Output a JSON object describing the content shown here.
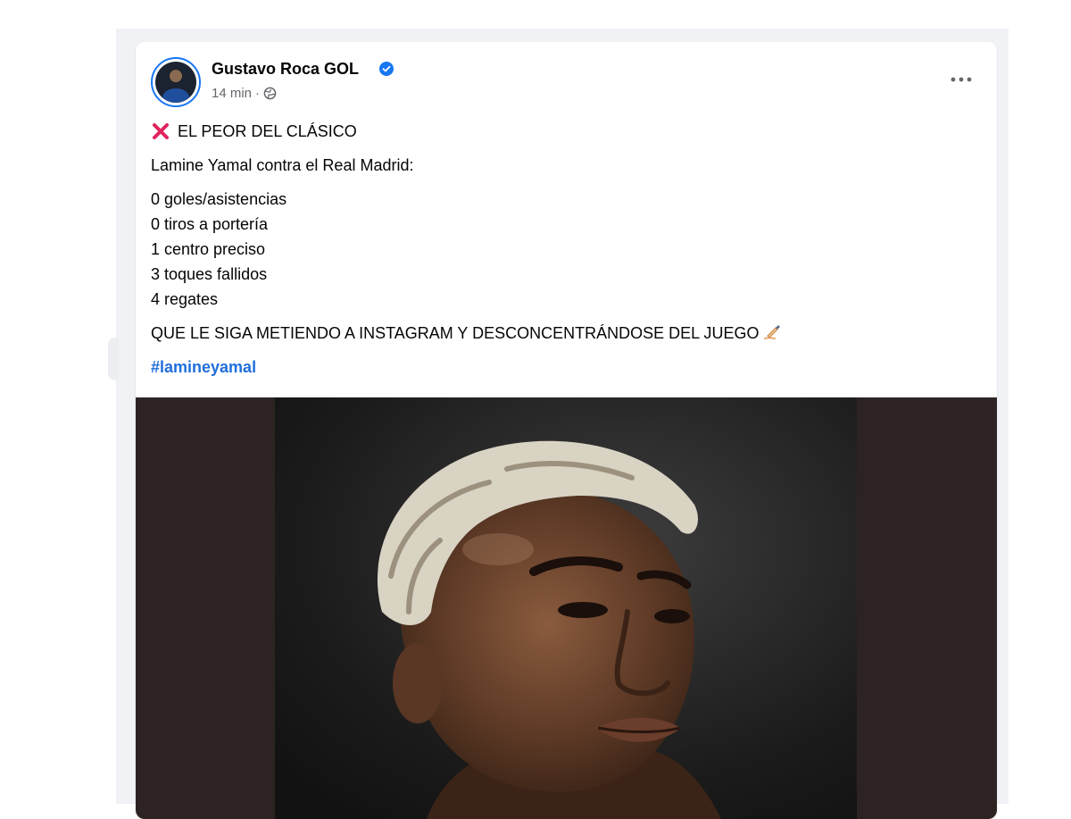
{
  "post": {
    "author": "Gustavo Roca GOL",
    "time": "14 min",
    "separator": "·",
    "headline": "EL PEOR DEL CLÁSICO",
    "intro": "Lamine Yamal contra el Real Madrid:",
    "stats": [
      "0 goles/asistencias",
      "0 tiros a portería",
      "1 centro preciso",
      "3 toques fallidos",
      "4 regates"
    ],
    "closing": "QUE LE SIGA METIENDO A INSTAGRAM Y DESCONCENTRÁNDOSE DEL JUEGO",
    "hashtag": "#lamineyamal"
  },
  "icons": {
    "verified": "verified-badge-icon",
    "audience": "globe-icon",
    "more": "more-options-icon",
    "headline": "red-cross-icon",
    "closing": "writing-hand-icon"
  },
  "colors": {
    "accent": "#1877f2",
    "hashtag": "#216fdb",
    "cross": "#e0245e"
  }
}
